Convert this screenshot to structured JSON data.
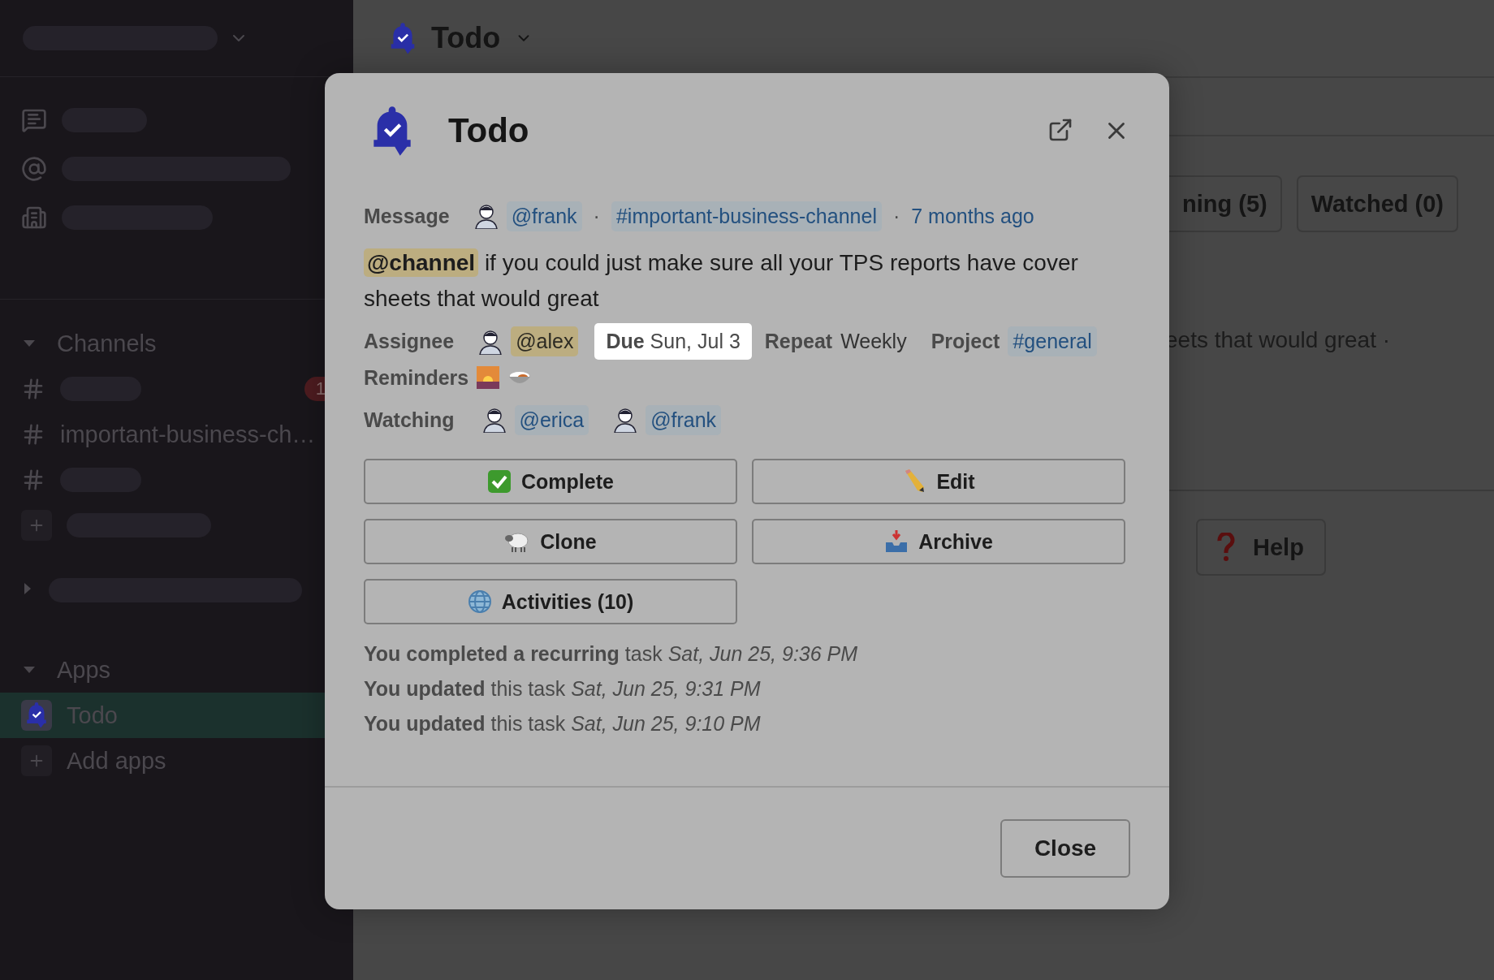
{
  "sidebar": {
    "sections": [
      {
        "label": "Channels",
        "expanded": true,
        "items": [
          {
            "kind": "skeleton",
            "badge": "1"
          },
          {
            "kind": "channel",
            "name": "important-business-ch…"
          },
          {
            "kind": "skeleton"
          },
          {
            "kind": "add"
          }
        ]
      },
      {
        "kind": "collapsed",
        "expanded": false
      },
      {
        "label": "Apps",
        "expanded": true,
        "items": [
          {
            "kind": "app",
            "name": "Todo",
            "selected": true
          },
          {
            "kind": "add",
            "name": "Add apps",
            "selected": false
          }
        ]
      }
    ]
  },
  "main": {
    "title": "Todo",
    "tabs": [
      {
        "label": "ning (5)"
      },
      {
        "label": "Watched (0)"
      }
    ],
    "preview": "eets that would great ·",
    "help": "Help"
  },
  "modal": {
    "title": "Todo",
    "message": {
      "label": "Message",
      "author": "@frank",
      "channel": "#important-business-channel",
      "time": "7 months ago",
      "separators": [
        "·",
        "·"
      ]
    },
    "body": {
      "mention": "@channel",
      "text": "if you could just make sure all your TPS reports have cover sheets that would great"
    },
    "assignee": {
      "label": "Assignee",
      "value": "@alex"
    },
    "due": {
      "label": "Due",
      "value": "Sun, Jul 3"
    },
    "repeat": {
      "label": "Repeat",
      "value": "Weekly"
    },
    "project": {
      "label": "Project",
      "value": "#general"
    },
    "reminders": {
      "label": "Reminders"
    },
    "watching": {
      "label": "Watching",
      "users": [
        "@erica",
        "@frank"
      ]
    },
    "buttons": [
      {
        "kind": "check",
        "label": "Complete"
      },
      {
        "kind": "pencil",
        "label": "Edit"
      },
      {
        "kind": "sheep",
        "label": "Clone"
      },
      {
        "kind": "inbox",
        "label": "Archive"
      },
      {
        "kind": "globe",
        "label": "Activities (10)"
      }
    ],
    "activities": [
      "**You completed a recurring** task *Sat, Jun 25, 9:36 PM*",
      "**You updated** this task *Sat, Jun 25, 9:31 PM*",
      "**You updated** this task *Sat, Jun 25, 9:10 PM*"
    ],
    "close": "Close"
  }
}
